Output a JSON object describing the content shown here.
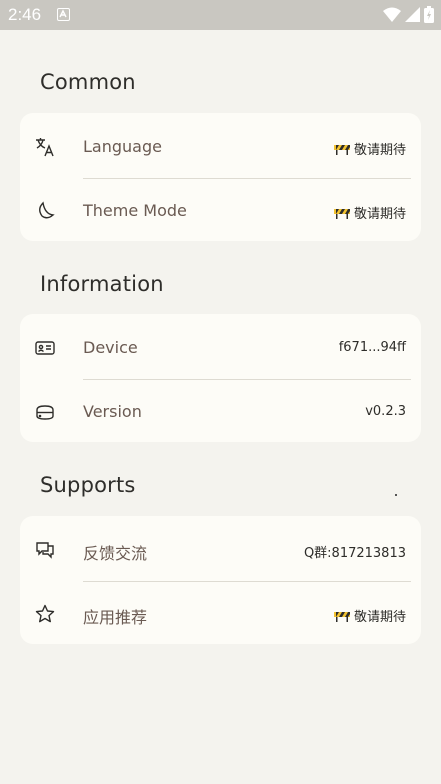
{
  "status_bar": {
    "time": "2:46"
  },
  "sections": [
    {
      "title": "Common",
      "rows": [
        {
          "label": "Language",
          "value": "敬请期待",
          "icon": "translate-icon"
        },
        {
          "label": "Theme Mode",
          "value": "敬请期待",
          "icon": "moon-icon"
        }
      ]
    },
    {
      "title": "Information",
      "rows": [
        {
          "label": "Device",
          "value": "f671...94ff",
          "icon": "id-card-icon"
        },
        {
          "label": "Version",
          "value": "v0.2.3",
          "icon": "stack-icon"
        }
      ]
    },
    {
      "title": "Supports",
      "rows": [
        {
          "label": "反馈交流",
          "value": "Q群:817213813",
          "icon": "chat-icon"
        },
        {
          "label": "应用推荐",
          "value": "敬请期待",
          "icon": "star-icon"
        }
      ]
    }
  ],
  "colors": {
    "background": "#f4f3ee",
    "card": "#fdfcf7",
    "label": "#6a5a52",
    "status_bar": "#c9c7c1"
  }
}
